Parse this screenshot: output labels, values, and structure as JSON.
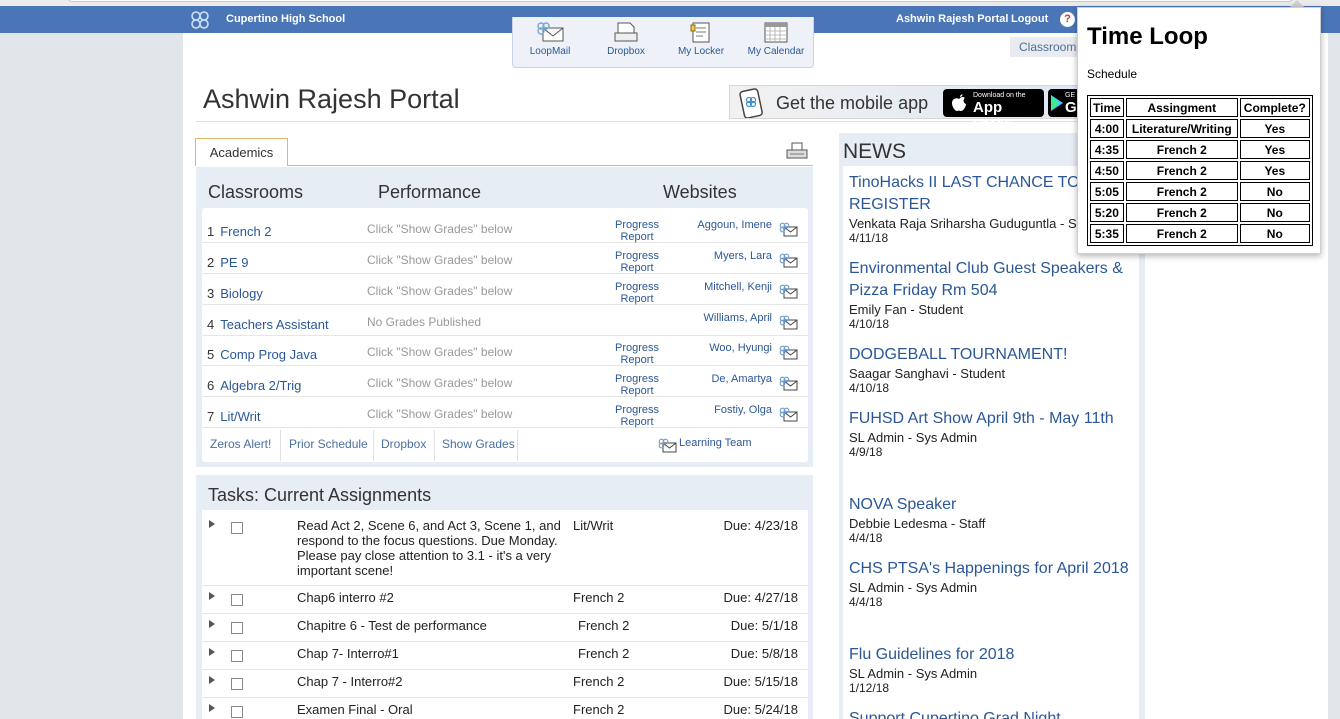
{
  "header": {
    "school": "Cupertino High School",
    "portal_link": "Ashwin Rajesh Portal",
    "logout": "Logout",
    "help": "?"
  },
  "quicknav": [
    {
      "label": "LoopMail",
      "icon": "loopmail-icon"
    },
    {
      "label": "Dropbox",
      "icon": "dropbox-icon"
    },
    {
      "label": "My Locker",
      "icon": "locker-icon"
    },
    {
      "label": "My Calendar",
      "icon": "calendar-icon"
    }
  ],
  "classroom_tab": "Classroom",
  "page_title": "Ashwin Rajesh Portal",
  "mobile_banner": {
    "text": "Get the mobile app",
    "appstore_small": "Download on the",
    "appstore_big": "App Store",
    "google_small": "GE",
    "google_big": "G"
  },
  "academics": {
    "tab": "Academics",
    "headers": {
      "classrooms": "Classrooms",
      "performance": "Performance",
      "websites": "Websites"
    },
    "classes": [
      {
        "num": "1",
        "name": "French 2",
        "performance": "Click \"Show Grades\" below",
        "progress": "Progress\nReport",
        "teacher": "Aggoun, Imene"
      },
      {
        "num": "2",
        "name": "PE 9",
        "performance": "Click \"Show Grades\" below",
        "progress": "Progress\nReport",
        "teacher": "Myers, Lara"
      },
      {
        "num": "3",
        "name": "Biology",
        "performance": "Click \"Show Grades\" below",
        "progress": "Progress\nReport",
        "teacher": "Mitchell, Kenji"
      },
      {
        "num": "4",
        "name": "Teachers Assistant",
        "performance": "No Grades Published",
        "progress": "",
        "teacher": "Williams, April"
      },
      {
        "num": "5",
        "name": "Comp Prog Java",
        "performance": "Click \"Show Grades\" below",
        "progress": "Progress\nReport",
        "teacher": "Woo, Hyungi"
      },
      {
        "num": "6",
        "name": "Algebra 2/Trig",
        "performance": "Click \"Show Grades\" below",
        "progress": "Progress\nReport",
        "teacher": "De, Amartya"
      },
      {
        "num": "7",
        "name": "Lit/Writ",
        "performance": "Click \"Show Grades\" below",
        "progress": "Progress\nReport",
        "teacher": "Fostiy, Olga"
      }
    ],
    "links": {
      "zeros": "Zeros Alert!",
      "prior": "Prior Schedule",
      "dropbox": "Dropbox",
      "grades": "Show Grades",
      "learning_team": "Learning Team"
    }
  },
  "tasks": {
    "title": "Tasks: Current Assignments",
    "items": [
      {
        "desc": "Read Act 2, Scene 6, and Act 3, Scene 1, and respond to the focus questions. Due Monday. Please pay close attention to 3.1 - it's a very important scene!",
        "class": "Lit/Writ",
        "due": "Due: 4/23/18"
      },
      {
        "desc": "Chap6 interro #2",
        "class": "French 2",
        "due": "Due: 4/27/18"
      },
      {
        "desc": "Chapitre 6 - Test de performance",
        "class": "French 2",
        "due": "Due: 5/1/18"
      },
      {
        "desc": "Chap 7- Interro#1",
        "class": "French 2",
        "due": "Due: 5/8/18"
      },
      {
        "desc": "Chap 7 - Interro#2",
        "class": "French 2",
        "due": "Due: 5/15/18"
      },
      {
        "desc": "Examen Final - Oral",
        "class": "French 2",
        "due": "Due: 5/24/18"
      }
    ]
  },
  "news": {
    "title": "NEWS",
    "items": [
      {
        "title": "TinoHacks II LAST CHANCE TO REGISTER",
        "author": "Venkata Raja Sriharsha Guduguntla - St",
        "date": "4/11/18"
      },
      {
        "title": "Environmental Club Guest Speakers & Pizza Friday Rm 504",
        "author": "Emily Fan - Student",
        "date": "4/10/18"
      },
      {
        "title": "DODGEBALL TOURNAMENT!",
        "author": "Saagar Sanghavi - Student",
        "date": "4/10/18"
      },
      {
        "title": "FUHSD Art Show April 9th - May 11th",
        "author": "SL Admin - Sys Admin",
        "date": "4/9/18"
      },
      {
        "title": "NOVA Speaker",
        "author": "Debbie Ledesma - Staff",
        "date": "4/4/18"
      },
      {
        "title": "CHS PTSA's Happenings for April 2018",
        "author": "SL Admin - Sys Admin",
        "date": "4/4/18"
      },
      {
        "title": "Flu Guidelines for 2018",
        "author": "SL Admin - Sys Admin",
        "date": "1/12/18"
      },
      {
        "title": "Support Cupertino Grad Night",
        "author": "",
        "date": ""
      }
    ]
  },
  "timeloop": {
    "title": "Time Loop",
    "subtitle": "Schedule",
    "headers": [
      "Time",
      "Assingment",
      "Complete?"
    ],
    "rows": [
      [
        "4:00",
        "Literature/Writing",
        "Yes"
      ],
      [
        "4:35",
        "French 2",
        "Yes"
      ],
      [
        "4:50",
        "French 2",
        "Yes"
      ],
      [
        "5:05",
        "French 2",
        "No"
      ],
      [
        "5:20",
        "French 2",
        "No"
      ],
      [
        "5:35",
        "French 2",
        "No"
      ]
    ]
  },
  "colors": {
    "header_blue": "#4a76b8",
    "link_blue": "#2b5797",
    "panel_bg": "#e7edf4",
    "tab_border": "#e6b566"
  }
}
